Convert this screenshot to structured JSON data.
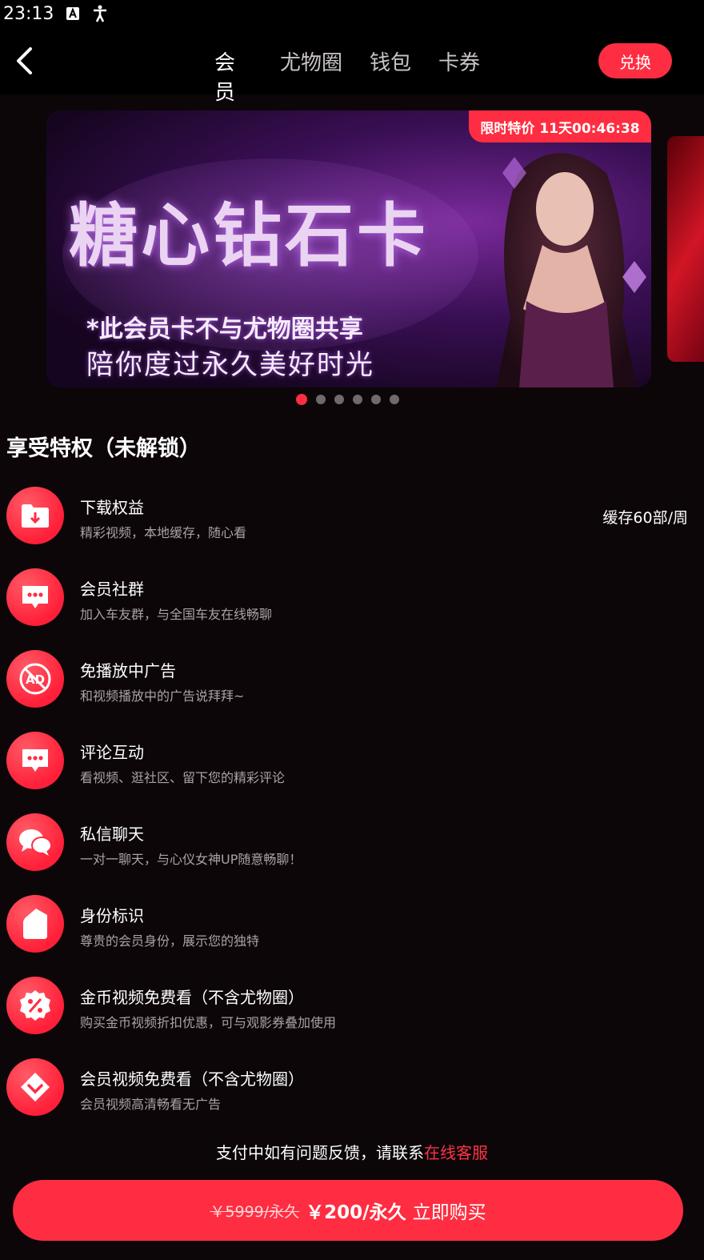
{
  "status_bar": {
    "time": "23:13",
    "icons": [
      "notification-a-icon",
      "accessibility-icon"
    ]
  },
  "header": {
    "back_icon": "chevron-left-icon",
    "tabs": [
      {
        "label": "会员",
        "active": true
      },
      {
        "label": "尤物圈",
        "active": false
      },
      {
        "label": "钱包",
        "active": false
      },
      {
        "label": "卡券",
        "active": false
      }
    ],
    "exchange_label": "兑换"
  },
  "banner": {
    "promo_badge": "限时特价 11天00:46:38",
    "title": "糖心钻石卡",
    "subtitle": "*此会员卡不与尤物圈共享",
    "tagline": "陪你度过永久美好时光",
    "dots_count": 6,
    "active_dot": 0
  },
  "privileges": {
    "section_title": "享受特权（未解锁）",
    "items": [
      {
        "icon": "download-folder-icon",
        "title": "下载权益",
        "desc": "精彩视频，本地缓存，随心看",
        "extra": "缓存60部/周"
      },
      {
        "icon": "chat-bubble-icon",
        "title": "会员社群",
        "desc": "加入车友群，与全国车友在线畅聊",
        "extra": ""
      },
      {
        "icon": "no-ad-icon",
        "title": "免播放中广告",
        "desc": "和视频播放中的广告说拜拜~",
        "extra": ""
      },
      {
        "icon": "comment-icon",
        "title": "评论互动",
        "desc": "看视频、逛社区、留下您的精彩评论",
        "extra": ""
      },
      {
        "icon": "wechat-icon",
        "title": "私信聊天",
        "desc": "一对一聊天，与心仪女神UP随意畅聊！",
        "extra": ""
      },
      {
        "icon": "identity-tag-icon",
        "title": "身份标识",
        "desc": "尊贵的会员身份，展示您的独特",
        "extra": ""
      },
      {
        "icon": "discount-badge-icon",
        "title": "金币视频免费看（不含尤物圈）",
        "desc": "购买金币视频折扣优惠，可与观影券叠加使用",
        "extra": ""
      },
      {
        "icon": "vip-diamond-icon",
        "title": "会员视频免费看（不含尤物圈）",
        "desc": "会员视频高清畅看无广告",
        "extra": ""
      }
    ]
  },
  "support": {
    "text": "支付中如有问题反馈，请联系",
    "link": "在线客服"
  },
  "purchase": {
    "old_price": "￥5999/永久",
    "new_price": "￥200/永久",
    "label": "立即购买"
  },
  "colors": {
    "accent": "#ff2d41",
    "background": "#0c0609",
    "desc_text": "#a9a2a6"
  }
}
